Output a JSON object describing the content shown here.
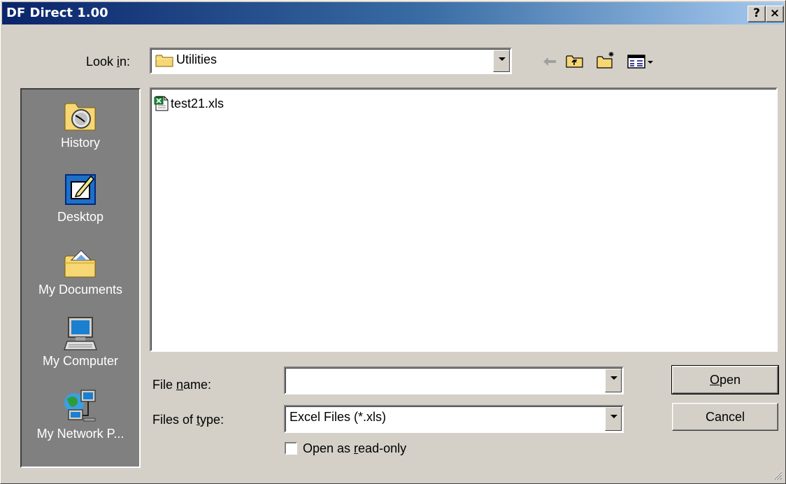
{
  "window": {
    "title": "DF Direct 1.00",
    "help_button": "?",
    "close_button": "×"
  },
  "lookin": {
    "label": "Look in:",
    "mnemonic_prefix": "Look ",
    "mnemonic": "i",
    "mnemonic_suffix": "n:",
    "value": "Utilities"
  },
  "places": [
    {
      "label": "History"
    },
    {
      "label": "Desktop"
    },
    {
      "label": "My Documents"
    },
    {
      "label": "My Computer"
    },
    {
      "label": "My Network P..."
    }
  ],
  "files": [
    {
      "name": "test21.xls"
    }
  ],
  "filename": {
    "label_pre": "File ",
    "label_mn": "n",
    "label_post": "ame:",
    "value": ""
  },
  "filetype": {
    "label_pre": "Files of ",
    "label_mn": "t",
    "label_post": "ype:",
    "value": "Excel Files (*.xls)"
  },
  "readonly": {
    "label_pre": "Open as ",
    "label_mn": "r",
    "label_post": "ead-only",
    "checked": false
  },
  "buttons": {
    "open_mn": "O",
    "open_rest": "pen",
    "cancel": "Cancel"
  },
  "colors": {
    "titlebar_start": "#0a246a",
    "titlebar_end": "#a6caf0",
    "face": "#d4d0c8",
    "places_bg": "#808080"
  }
}
